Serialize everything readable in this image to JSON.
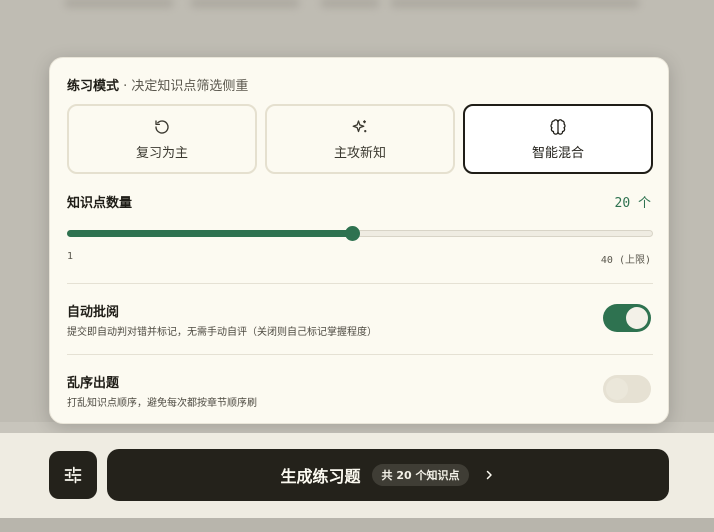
{
  "practice_mode": {
    "title": "练习模式",
    "subtitle": " · 决定知识点筛选侧重",
    "options": [
      {
        "label": "复习为主",
        "icon": "refresh-icon",
        "selected": false
      },
      {
        "label": "主攻新知",
        "icon": "sparkle-icon",
        "selected": false
      },
      {
        "label": "智能混合",
        "icon": "brain-icon",
        "selected": true
      }
    ]
  },
  "count": {
    "label": "知识点数量",
    "value_text": "20 个",
    "value": 20,
    "min": 1,
    "max": 40,
    "min_label": "1",
    "max_label": "40 (上限)"
  },
  "auto_grade": {
    "title": "自动批阅",
    "description": "提交即自动判对错并标记，无需手动自评（关闭则自己标记掌握程度）",
    "enabled": true
  },
  "shuffle": {
    "title": "乱序出题",
    "description": "打乱知识点顺序，避免每次都按章节顺序刷",
    "enabled": false
  },
  "footer": {
    "settings_icon": "sliders-icon",
    "generate_label": "生成练习题",
    "badge": "共 20 个知识点",
    "chevron_icon": "chevron-right-icon"
  },
  "colors": {
    "accent": "#2e7250",
    "dark": "#24221b",
    "panel": "#fcfaf1"
  }
}
